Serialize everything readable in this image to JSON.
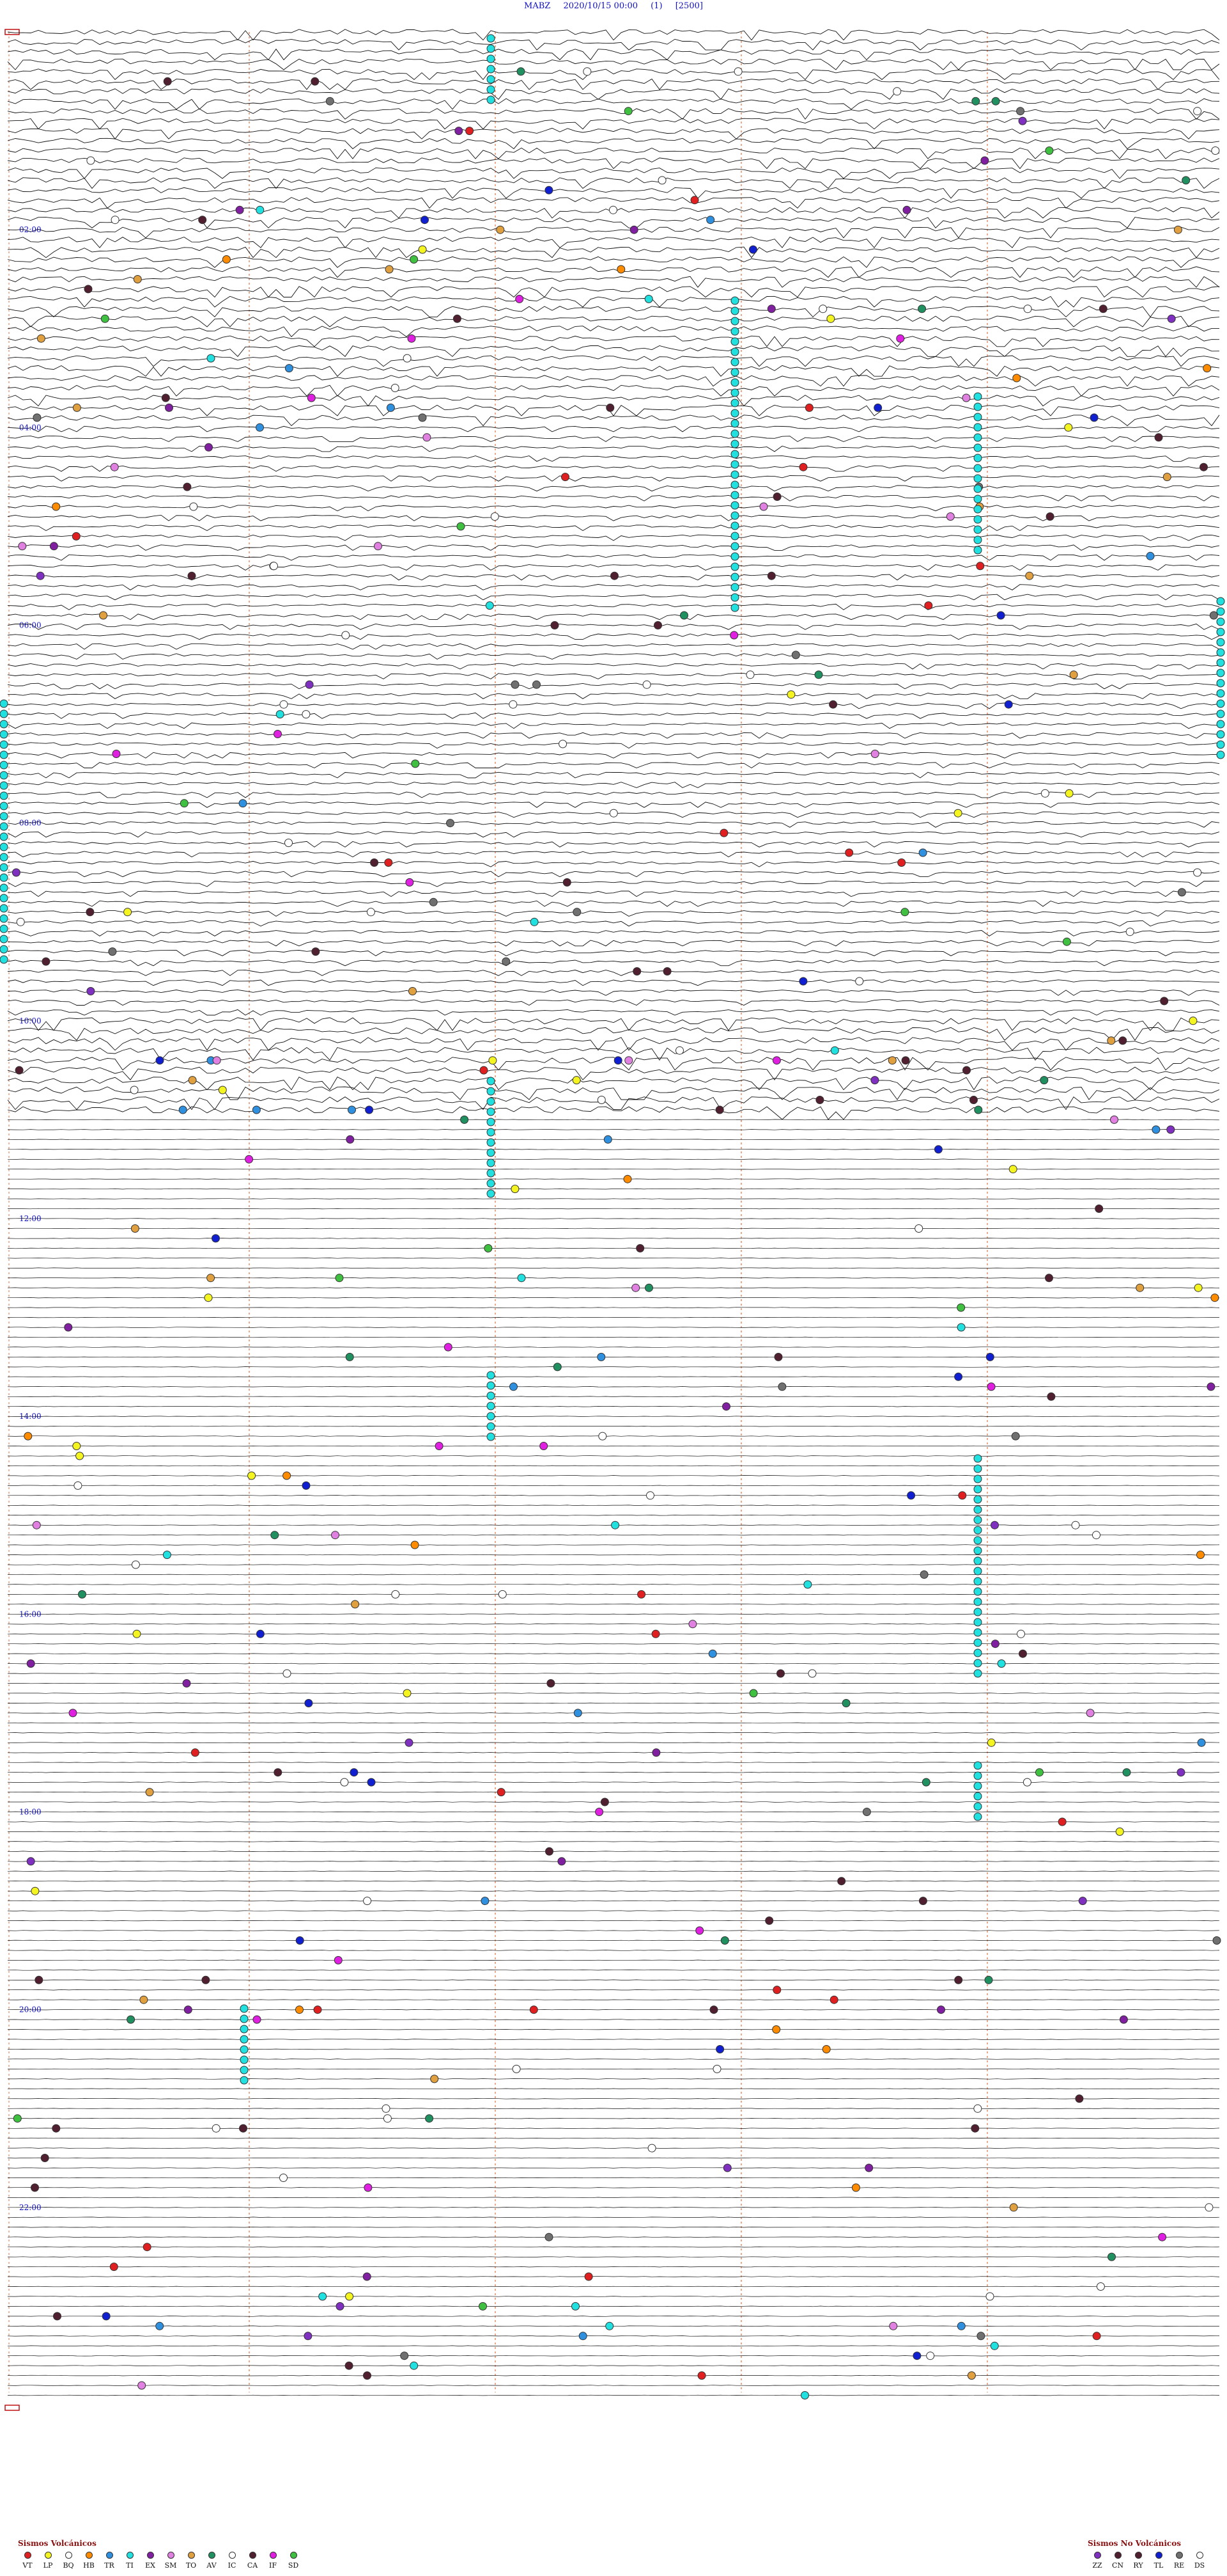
{
  "header": {
    "station": "MABZ",
    "datetime": "2020/10/15 00:00",
    "channel": "(1)",
    "scale": "[2500]"
  },
  "chart_data": {
    "type": "helicorder",
    "title": "MABZ 2020/10/15 00:00 (1) [2500]",
    "hour_labels": [
      "02:00",
      "04:00",
      "06:00",
      "08:00",
      "10:00",
      "12:00",
      "14:00",
      "16:00",
      "18:00",
      "20:00",
      "22:00"
    ],
    "traces_per_hour": 10,
    "hours": 24,
    "colors": {
      "trace": "#111111",
      "marker": "#e07040",
      "label": "#1010c0",
      "frame": "#c01010"
    }
  },
  "legend_volcanic": {
    "title": "Sismos Volcánicos",
    "items": [
      {
        "code": "VT",
        "color": "#e02020"
      },
      {
        "code": "LP",
        "color": "#f4f420"
      },
      {
        "code": "BQ",
        "color": "#ffffff"
      },
      {
        "code": "HB",
        "color": "#ff8c00"
      },
      {
        "code": "TR",
        "color": "#3090e0"
      },
      {
        "code": "TI",
        "color": "#20e0e0"
      },
      {
        "code": "EX",
        "color": "#8020a0"
      },
      {
        "code": "SM",
        "color": "#e080e0"
      },
      {
        "code": "TO",
        "color": "#e0a040"
      },
      {
        "code": "AV",
        "color": "#209060"
      },
      {
        "code": "IC",
        "color": "#ffffff"
      },
      {
        "code": "CA",
        "color": "#502030"
      },
      {
        "code": "IF",
        "color": "#e020e0"
      },
      {
        "code": "SD",
        "color": "#40c040"
      }
    ]
  },
  "legend_nonvolcanic": {
    "title": "Sismos No Volcánicos",
    "items": [
      {
        "code": "ZZ",
        "color": "#8030c0"
      },
      {
        "code": "CN",
        "color": "#502030"
      },
      {
        "code": "RY",
        "color": "#502030"
      },
      {
        "code": "TL",
        "color": "#1020d0"
      },
      {
        "code": "RE",
        "color": "#707070"
      },
      {
        "code": "DS",
        "color": "#ffffff"
      }
    ]
  }
}
